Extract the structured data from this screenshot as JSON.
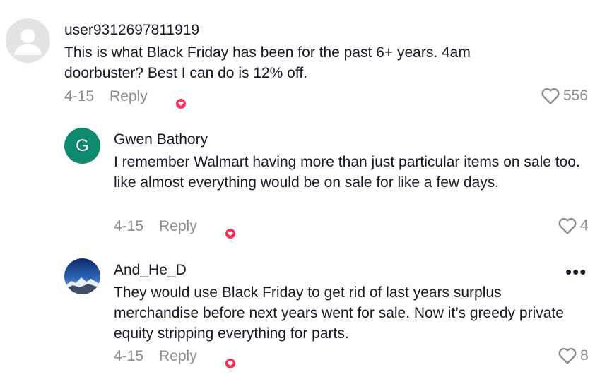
{
  "comments": [
    {
      "username": "user9312697811919",
      "text": "This is what Black Friday has been for the past 6+ years. 4am doorbuster? Best I can do is 12% off.",
      "date": "4-15",
      "reply_label": "Reply",
      "likes": "556",
      "avatar": {
        "type": "placeholder",
        "color": "#e3e3e4"
      }
    },
    {
      "username": "Gwen Bathory",
      "text": "I remember Walmart having more than just particular items on sale too. like almost everything would be on sale for like a few days.",
      "date": "4-15",
      "reply_label": "Reply",
      "likes": "4",
      "avatar": {
        "type": "initial",
        "initial": "G",
        "color": "#0f8a6e"
      }
    },
    {
      "username": "And_He_D",
      "text": "They would use Black Friday to get rid of last years surplus merchandise before next years went for sale. Now it’s greedy private equity stripping everything for parts.",
      "date": "4-15",
      "reply_label": "Reply",
      "likes": "8",
      "avatar": {
        "type": "photo",
        "description": "mountain"
      },
      "more_label": "•••"
    }
  ],
  "colors": {
    "text_primary": "#161823",
    "text_secondary": "#8a8b91",
    "creator_heart": "#fe2c55"
  },
  "icons": {
    "like": "heart-outline-icon",
    "creator_liked": "creator-liked-icon",
    "more": "more-icon"
  }
}
